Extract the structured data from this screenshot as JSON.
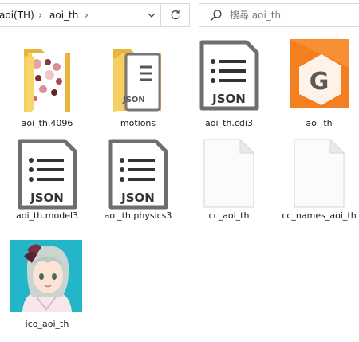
{
  "address_bar": {
    "crumbs": [
      "aoi(TH)",
      "aoi_th"
    ],
    "separator": "›",
    "dropdown_icon": "chevron-down-icon",
    "refresh_icon": "refresh-icon"
  },
  "search": {
    "placeholder": "搜尋 aoi_th",
    "value": "",
    "icon": "search-icon"
  },
  "files": [
    {
      "name": "aoi_th.4096",
      "type": "folder-with-images"
    },
    {
      "name": "motions",
      "type": "folder-with-json"
    },
    {
      "name": "aoi_th.cdi3",
      "type": "json-file"
    },
    {
      "name": "aoi_th",
      "type": "gimp-style-app-file",
      "badge": "G"
    },
    {
      "name": "aoi_th.model3",
      "type": "json-file"
    },
    {
      "name": "aoi_th.physics3",
      "type": "json-file"
    },
    {
      "name": "cc_aoi_th",
      "type": "blank-file"
    },
    {
      "name": "cc_names_aoi_th",
      "type": "blank-file"
    },
    {
      "name": "ico_aoi_th",
      "type": "image-thumbnail"
    }
  ],
  "json_badge": "JSON",
  "colors": {
    "folder": "#f6cf62",
    "folder_dark": "#e8b53c",
    "json_frame": "#6e6e6e",
    "app_orange": "#f47f20",
    "thumb_bg": "#22b6c8"
  }
}
